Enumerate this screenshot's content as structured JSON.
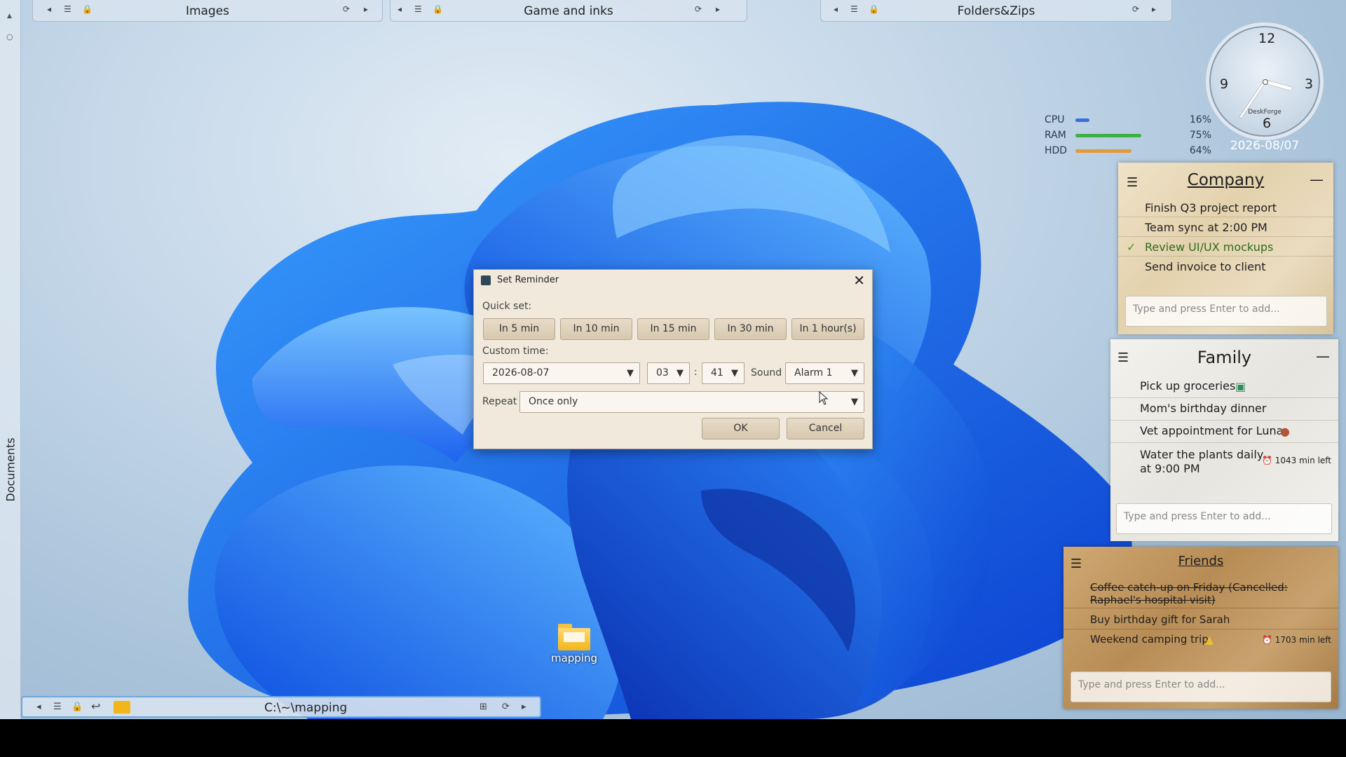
{
  "sidebar": {
    "label": "Documents"
  },
  "fences": [
    {
      "title": "Images"
    },
    {
      "title": "Game and inks"
    },
    {
      "title": "Folders&Zips"
    }
  ],
  "clock": {
    "n12": "12",
    "n3": "3",
    "n6": "6",
    "n9": "9",
    "brand": "DeskForge",
    "date": "2026-08/07"
  },
  "system": [
    {
      "label": "CPU",
      "value": "16%",
      "fraction": 0.16,
      "color": "#3b6fd8"
    },
    {
      "label": "RAM",
      "value": "75%",
      "fraction": 0.75,
      "color": "#3cb043"
    },
    {
      "label": "HDD",
      "value": "64%",
      "fraction": 0.64,
      "color": "#e39a3a"
    }
  ],
  "notes": {
    "company": {
      "title": "Company",
      "items": [
        "Finish Q3 project report",
        "Team sync at 2:00 PM",
        "Review UI/UX mockups",
        "Send invoice to client"
      ],
      "placeholder": "Type and press Enter to add..."
    },
    "family": {
      "title": "Family",
      "items": [
        "Pick up groceries",
        "Mom's birthday dinner",
        "Vet appointment for Luna",
        "Water the plants daily at 9:00 PM"
      ],
      "time_left": "1043 min left",
      "placeholder": "Type and press Enter to add..."
    },
    "friends": {
      "title": "Friends",
      "items": [
        "Coffee catch-up on Friday (Cancelled: Raphael's hospital visit)",
        "Buy birthday gift for Sarah",
        "Weekend camping trip"
      ],
      "time_left": "1703 min left",
      "placeholder": "Type and press Enter to add..."
    }
  },
  "taskbar": {
    "path": "C:\\~\\mapping"
  },
  "desktop_icon": {
    "label": "mapping"
  },
  "dialog": {
    "title": "Set Reminder",
    "quick_label": "Quick set:",
    "quick": [
      "In 5 min",
      "In 10 min",
      "In 15 min",
      "In 30 min",
      "In 1 hour(s)"
    ],
    "custom_label": "Custom time:",
    "date": "2026-08-07",
    "hour": "03",
    "colon": ":",
    "minute": "41",
    "sound_label": "Sound",
    "sound": "Alarm 1",
    "repeat_label": "Repeat",
    "repeat": "Once only",
    "ok": "OK",
    "cancel": "Cancel"
  }
}
